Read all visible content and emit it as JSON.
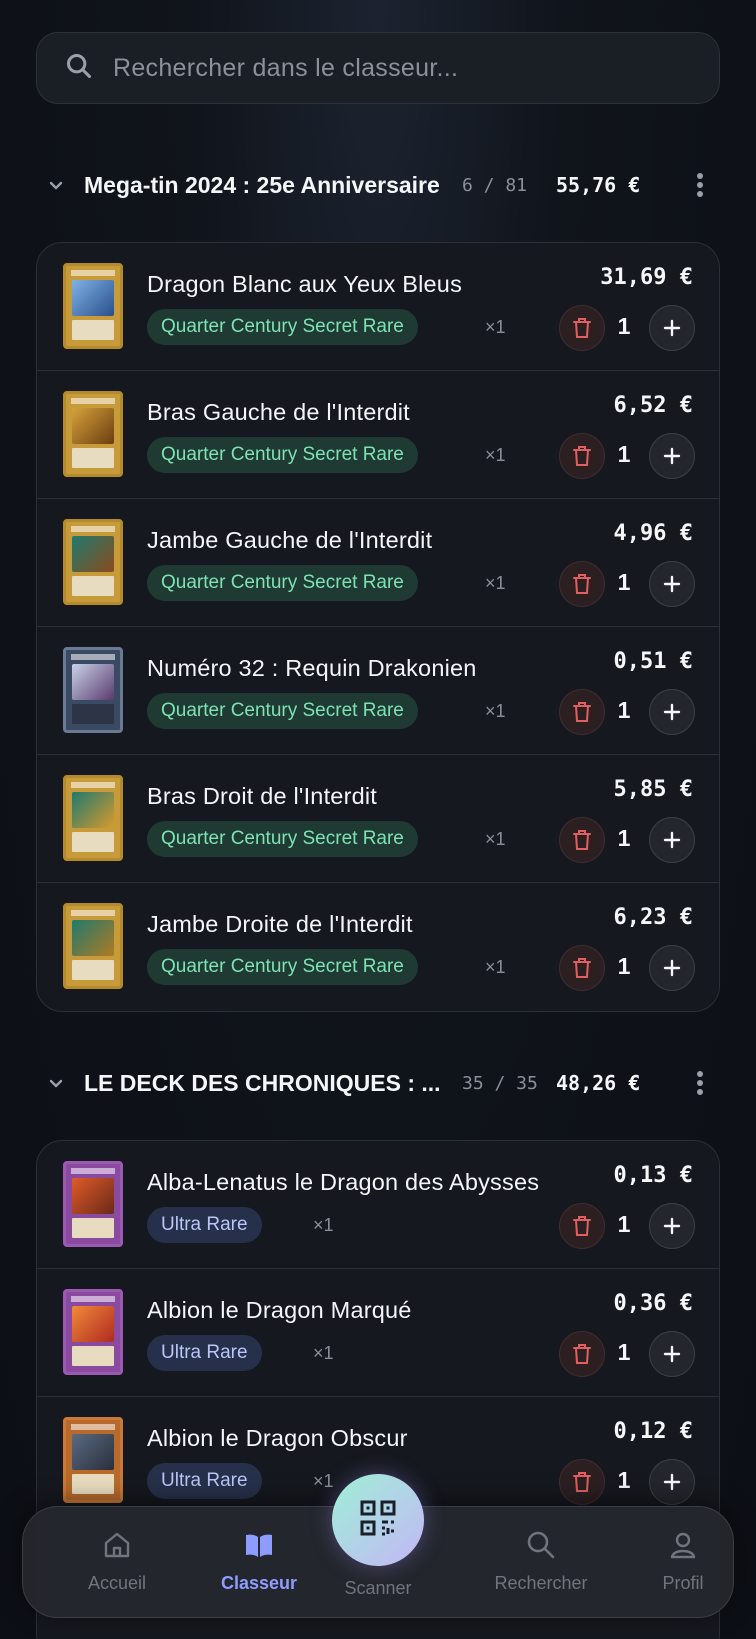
{
  "search": {
    "placeholder": "Rechercher dans le classeur..."
  },
  "sections": [
    {
      "title": "Mega-tin 2024 : 25e Anniversaire",
      "count": "6 / 81",
      "value": "55,76 €",
      "cards": [
        {
          "name": "Dragon Blanc aux Yeux Bleus",
          "rarity": "Quarter Century Secret Rare",
          "mult": "×1",
          "price": "31,69 €",
          "qty": "1"
        },
        {
          "name": "Bras Gauche de l'Interdit",
          "rarity": "Quarter Century Secret Rare",
          "mult": "×1",
          "price": "6,52 €",
          "qty": "1"
        },
        {
          "name": "Jambe Gauche de l'Interdit",
          "rarity": "Quarter Century Secret Rare",
          "mult": "×1",
          "price": "4,96 €",
          "qty": "1"
        },
        {
          "name": "Numéro 32 : Requin Drakonien",
          "rarity": "Quarter Century Secret Rare",
          "mult": "×1",
          "price": "0,51 €",
          "qty": "1"
        },
        {
          "name": "Bras Droit de l'Interdit",
          "rarity": "Quarter Century Secret Rare",
          "mult": "×1",
          "price": "5,85 €",
          "qty": "1"
        },
        {
          "name": "Jambe Droite de l'Interdit",
          "rarity": "Quarter Century Secret Rare",
          "mult": "×1",
          "price": "6,23 €",
          "qty": "1"
        }
      ]
    },
    {
      "title": "LE DECK DES CHRONIQUES : ...",
      "count": "35 / 35",
      "value": "48,26 €",
      "cards": [
        {
          "name": "Alba-Lenatus le Dragon des Abysses",
          "rarity": "Ultra Rare",
          "mult": "×1",
          "price": "0,13 €",
          "qty": "1"
        },
        {
          "name": "Albion le Dragon Marqué",
          "rarity": "Ultra Rare",
          "mult": "×1",
          "price": "0,36 €",
          "qty": "1"
        },
        {
          "name": "Albion le Dragon Obscur",
          "rarity": "Ultra Rare",
          "mult": "×1",
          "price": "0,12 €",
          "qty": "1"
        }
      ]
    }
  ],
  "nav": {
    "home": "Accueil",
    "binder": "Classeur",
    "scanner": "Scanner",
    "search": "Rechercher",
    "profile": "Profil"
  },
  "colors": {
    "accent": "#8f9cff",
    "qcsr_badge_text": "#7ee2b5",
    "ultra_rare_badge_text": "#b9c6f6",
    "delete": "#e0605f"
  }
}
